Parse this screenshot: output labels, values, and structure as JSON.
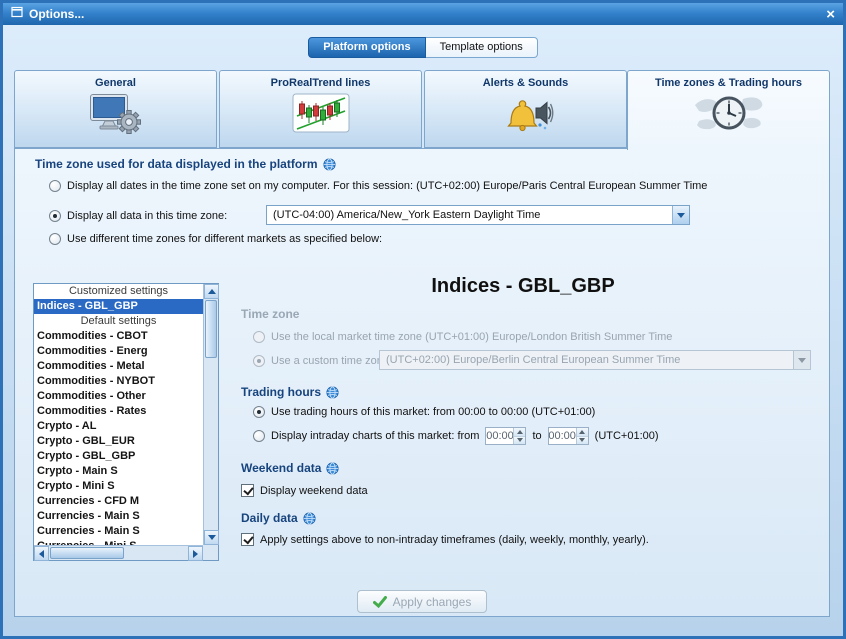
{
  "window": {
    "title": "Options...",
    "close_symbol": "×"
  },
  "top_tabs": {
    "platform": "Platform options",
    "template": "Template options"
  },
  "main_tabs": {
    "general": "General",
    "proreal": "ProRealTrend lines",
    "alerts": "Alerts & Sounds",
    "timezones": "Time zones & Trading hours"
  },
  "timezone_options": {
    "heading": "Time zone used for data displayed in the platform",
    "computer_option": "Display all dates in the time zone set on my computer. For this session:  (UTC+02:00) Europe/Paris Central European Summer Time",
    "custom_option": "Display all data in this time zone:",
    "custom_value": "(UTC-04:00) America/New_York Eastern Daylight Time",
    "per_market_option": "Use different time zones for different markets as specified below:"
  },
  "market_list": {
    "rows": [
      {
        "type": "header",
        "label": "Customized settings"
      },
      {
        "type": "item",
        "label": "Indices - GBL_GBP",
        "selected": true
      },
      {
        "type": "header",
        "label": "Default settings"
      },
      {
        "type": "item",
        "label": "Commodities - CBOT"
      },
      {
        "type": "item",
        "label": "Commodities - Energ"
      },
      {
        "type": "item",
        "label": "Commodities - Metal"
      },
      {
        "type": "item",
        "label": "Commodities - NYBOT"
      },
      {
        "type": "item",
        "label": "Commodities - Other"
      },
      {
        "type": "item",
        "label": "Commodities - Rates"
      },
      {
        "type": "item",
        "label": "Crypto - AL"
      },
      {
        "type": "item",
        "label": "Crypto - GBL_EUR"
      },
      {
        "type": "item",
        "label": "Crypto - GBL_GBP"
      },
      {
        "type": "item",
        "label": "Crypto - Main S"
      },
      {
        "type": "item",
        "label": "Crypto - Mini S"
      },
      {
        "type": "item",
        "label": "Currencies - CFD M"
      },
      {
        "type": "item",
        "label": "Currencies - Main S"
      },
      {
        "type": "item",
        "label": "Currencies - Main S"
      },
      {
        "type": "item",
        "label": "Currencies - Mini S"
      }
    ]
  },
  "market_detail": {
    "title": "Indices - GBL_GBP",
    "timezone_heading": "Time zone",
    "local_tz_option": "Use the local market time zone (UTC+01:00) Europe/London British Summer Time",
    "custom_tz_option": "Use a custom time zone:",
    "custom_tz_value": "(UTC+02:00) Europe/Berlin Central European Summer Time",
    "trading_heading": "Trading hours",
    "market_hours_option": "Use trading hours of this market: from 00:00 to 00:00  (UTC+01:00)",
    "intraday_option": "Display intraday charts of this market:  from",
    "intraday_from": "00:00",
    "to_label": "to",
    "intraday_to": "00:00",
    "intraday_suffix": "(UTC+01:00)",
    "weekend_heading": "Weekend data",
    "weekend_checkbox": "Display weekend data",
    "daily_heading": "Daily data",
    "daily_checkbox": "Apply settings above to non-intraday timeframes (daily, weekly, monthly, yearly)."
  },
  "footer": {
    "apply_label": "Apply changes"
  }
}
